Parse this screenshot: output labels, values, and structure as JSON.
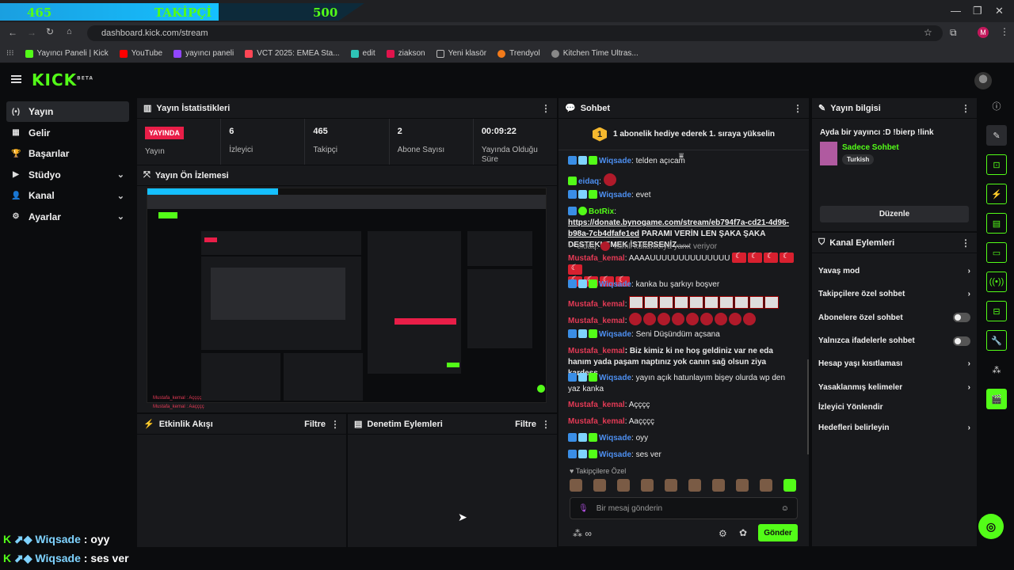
{
  "browser": {
    "overlay": {
      "left": "465",
      "center": "TAKİPÇİ",
      "right": "500"
    },
    "url": "dashboard.kick.com/stream",
    "bookmarks": [
      "Yayıncı Paneli | Kick",
      "YouTube",
      "yayıncı paneli",
      "VCT 2025: EMEA Sta...",
      "edit",
      "ziakson",
      "Yeni klasör",
      "Trendyol",
      "Kitchen Time Ultras..."
    ],
    "profile_initial": "M"
  },
  "nav": {
    "logo": "KICK",
    "logo_tag": "BETA",
    "items": [
      {
        "label": "Yayın",
        "icon": "(•)"
      },
      {
        "label": "Gelir",
        "icon": "▦"
      },
      {
        "label": "Başarılar",
        "icon": "🏆"
      },
      {
        "label": "Stüdyo",
        "icon": "▶"
      },
      {
        "label": "Kanal",
        "icon": "👤"
      },
      {
        "label": "Ayarlar",
        "icon": "⚙"
      }
    ]
  },
  "stats_panel": {
    "title": "Yayın İstatistikleri",
    "live_badge": "YAYINDA",
    "live_label": "Yayın",
    "stats": [
      {
        "value": "6",
        "label": "İzleyici"
      },
      {
        "value": "465",
        "label": "Takipçi"
      },
      {
        "value": "2",
        "label": "Abone Sayısı"
      },
      {
        "value": "00:09:22",
        "label": "Yayında Olduğu Süre"
      }
    ]
  },
  "preview_panel": {
    "title": "Yayın Ön İzlemesi",
    "overlay_line1": "Mustafa_kemal : Açççç",
    "overlay_line2": "Mustafa_kemal : Aaçççç"
  },
  "activity_panel": {
    "title": "Etkinlik Akışı",
    "filter": "Filtre"
  },
  "mod_panel": {
    "title": "Denetim Eylemleri",
    "filter": "Filtre"
  },
  "chat": {
    "title": "Sohbet",
    "pin_badge": "1",
    "pin_text": "1 abonelik hediye ederek 1. sıraya yükselin",
    "messages": {
      "m0": {
        "user": "Wiqsade",
        "text": "telden açıcam"
      },
      "m1": {
        "user": "eidaq",
        "text": ""
      },
      "m2": {
        "user": "Wiqsade",
        "text": "evet"
      },
      "m3": {
        "user": "BotRix",
        "link": "https://donate.bynogame.com/stream/eb794f7a-cd21-4d96-b98a-7cb4dfafe1ed",
        "text": " PARAMI VERİN LEN ŞAKA ŞAKA DESTEKLEMEK İSTERSENİZ......"
      },
      "m4": {
        "reply": "eidaq:",
        "reply_text": "İsimli kullanıcıya yanıt veriyor"
      },
      "m5": {
        "user": "Mustafa_kemal",
        "text": "AAAAUUUUUUUUUUUUUU"
      },
      "m6": {
        "user": "Wiqsade",
        "text": "kanka bu şarkıyı boşver"
      },
      "m7": {
        "user": "Mustafa_kemal",
        "text": ""
      },
      "m8": {
        "user": "Mustafa_kemal",
        "text": ""
      },
      "m9": {
        "user": "Wiqsade",
        "text": "Seni Düşündüm açsana"
      },
      "m10": {
        "user": "Mustafa_kemal",
        "text": "Biz kimiz ki ne hoş geldiniz var ne eda hanım yada paşam naptınız yok canın sağ olsun ziya kardeşş"
      },
      "m11": {
        "user": "Wiqsade",
        "text": "yayın açık hatunlayım bişey olurda wp den yaz kanka"
      },
      "m12": {
        "user": "Mustafa_kemal",
        "text": "Açççç"
      },
      "m13": {
        "user": "Mustafa_kemal",
        "text": "Aaçççç"
      },
      "m14": {
        "user": "Wiqsade",
        "text": "oyy"
      },
      "m15": {
        "user": "Wiqsade",
        "text": "ses ver"
      }
    },
    "followers_only": "Takipçilere Özel",
    "input_placeholder": "Bir mesaj gönderin",
    "send_label": "Gönder",
    "points": "∞"
  },
  "stream_info": {
    "title": "Yayın bilgisi",
    "stream_title": "Ayda bir yayıncı :D !bierp !link",
    "category": "Sadece Sohbet",
    "tag": "Turkish",
    "edit_label": "Düzenle"
  },
  "channel_actions": {
    "title": "Kanal Eylemleri",
    "items": [
      "Yavaş mod",
      "Takipçilere özel sohbet",
      "Abonelere özel sohbet",
      "Yalnızca ifadelerle sohbet",
      "Hesap yaşı kısıtlaması",
      "Yasaklanmış kelimeler",
      "İzleyici Yönlendir",
      "Hedefleri belirleyin"
    ]
  },
  "overlay_chat": {
    "l1": {
      "user": "Wiqsade",
      "text": "oyy"
    },
    "l2": {
      "user": "Wiqsade",
      "text": "ses ver"
    }
  },
  "colors": {
    "brand": "#53fc18",
    "live": "#e91e48",
    "overlay": "#15c0ff"
  }
}
